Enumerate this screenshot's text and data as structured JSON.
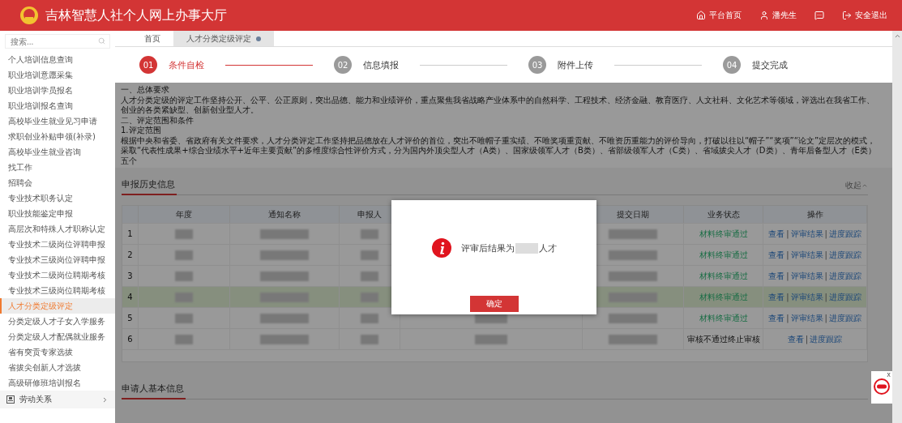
{
  "header": {
    "title": "吉林智慧人社个人网上办事大厅",
    "links": [
      {
        "kind": "home",
        "label": "平台首页"
      },
      {
        "kind": "user",
        "label": "潘先生"
      },
      {
        "kind": "message"
      },
      {
        "kind": "logout",
        "label": "安全退出"
      }
    ]
  },
  "sidebar": {
    "search": {
      "placeholder": "搜索..."
    },
    "items": [
      {
        "label": "个人培训信息查询",
        "selected": false
      },
      {
        "label": "职业培训意愿采集",
        "selected": false
      },
      {
        "label": "职业培训学员报名",
        "selected": false
      },
      {
        "label": "职业培训报名查询",
        "selected": false
      },
      {
        "label": "高校毕业生就业见习申请",
        "selected": false
      },
      {
        "label": "求职创业补贴申领(补录)",
        "selected": false
      },
      {
        "label": "高校毕业生就业咨询",
        "selected": false
      },
      {
        "label": "找工作",
        "selected": false
      },
      {
        "label": "招聘会",
        "selected": false
      },
      {
        "label": "专业技术职务认定",
        "selected": false
      },
      {
        "label": "职业技能鉴定申报",
        "selected": false
      },
      {
        "label": "高层次和特殊人才职称认定",
        "selected": false
      },
      {
        "label": "专业技术二级岗位评聘申报",
        "selected": false
      },
      {
        "label": "专业技术三级岗位评聘申报",
        "selected": false
      },
      {
        "label": "专业技术二级岗位聘期考核",
        "selected": false
      },
      {
        "label": "专业技术三级岗位聘期考核",
        "selected": false
      },
      {
        "label": "人才分类定级评定",
        "selected": true
      },
      {
        "label": "分类定级人才子女入学服务",
        "selected": false
      },
      {
        "label": "分类定级人才配偶就业服务",
        "selected": false
      },
      {
        "label": "省有突贡专家选拔",
        "selected": false
      },
      {
        "label": "省拔尖创新人才选拔",
        "selected": false
      },
      {
        "label": "高级研修班培训报名",
        "selected": false
      }
    ],
    "groups": [
      {
        "label": "劳动关系",
        "expanded": false
      }
    ]
  },
  "tabs": [
    {
      "label": "首页",
      "selected": false,
      "closable": false
    },
    {
      "label": "人才分类定级评定",
      "selected": true,
      "closable": true
    }
  ],
  "steps": [
    {
      "number": "01",
      "label": "条件自检",
      "selected": true
    },
    {
      "number": "02",
      "label": "信息填报",
      "selected": false
    },
    {
      "number": "03",
      "label": "附件上传",
      "selected": false
    },
    {
      "number": "04",
      "label": "提交完成",
      "selected": false
    }
  ],
  "intro": {
    "lines": [
      "一、总体要求",
      "人才分类定级的评定工作坚持公开、公平、公正原则，突出品德、能力和业绩评价，重点聚焦我省战略产业体系中的自然科学、工程技术、经济金融、教育医疗、人文社科、文化艺术等领域，评选出在我省工作、创业的各类紧缺型、创新创业型人才。",
      "二、评定范围和条件",
      "1.评定范围",
      "根据中央和省委、省政府有关文件要求，人才分类评定工作坚持把品德放在人才评价的首位，突出不唯帽子重实绩、不唯奖项重贡献、不唯资历重能力的评价导向，打破以往以“帽子”“奖项”“论文”定层次的模式，采取“代表性成果+综合业绩水平+近年主要贡献”的多维度综合性评价方式，分为国内外顶尖型人才（A类）、国家级领军人才（B类）、省部级领军人才（C类）、省域拔尖人才（D类）、青年后备型人才（E类）五个"
    ]
  },
  "history": {
    "title": "申报历史信息",
    "toggle": "收起",
    "separator": "|",
    "columns": [
      "年度",
      "通知名称",
      "申报人",
      "提交日期",
      "业务状态",
      "操作"
    ],
    "rows": [
      {
        "number": "1",
        "status": "材料终审通过",
        "kind": "passed",
        "actions": [
          "查看",
          "评审结果",
          "进度跟踪"
        ],
        "selected": false
      },
      {
        "number": "2",
        "status": "材料终审通过",
        "kind": "passed",
        "actions": [
          "查看",
          "评审结果",
          "进度跟踪"
        ],
        "selected": false
      },
      {
        "number": "3",
        "status": "材料终审通过",
        "kind": "passed",
        "actions": [
          "查看",
          "评审结果",
          "进度跟踪"
        ],
        "selected": false
      },
      {
        "number": "4",
        "status": "材料终审通过",
        "kind": "passed",
        "actions": [
          "查看",
          "评审结果",
          "进度跟踪"
        ],
        "selected": true
      },
      {
        "number": "5",
        "status": "材料终审通过",
        "kind": "passed",
        "actions": [
          "查看",
          "评审结果",
          "进度跟踪"
        ],
        "selected": false
      },
      {
        "number": "6",
        "status": "审核不通过终止审核",
        "kind": "terminated",
        "actions": [
          "查看",
          "进度跟踪"
        ],
        "selected": false
      }
    ]
  },
  "applicant": {
    "title": "申请人基本信息"
  },
  "dialog": {
    "message_before": "评审后结果为",
    "message_after": "人才",
    "button": "确定"
  },
  "float_widget": {
    "close": "x"
  }
}
